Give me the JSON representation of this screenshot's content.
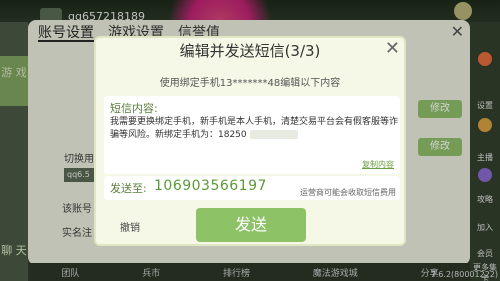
{
  "topbar": {
    "username": "qq657218189"
  },
  "left_tabs": [
    {
      "label": "游\n戏"
    },
    {
      "label": "聊\n天"
    }
  ],
  "settings": {
    "tabs": [
      {
        "label": "账号设置"
      },
      {
        "label": "游戏设置"
      },
      {
        "label": "信誉值"
      }
    ],
    "switch_label": "切换用",
    "account_label": "该账号",
    "verify_label": "实名注",
    "chip_text": "qq6.5",
    "buttons": [
      {
        "label": "修改"
      },
      {
        "label": "修改"
      }
    ]
  },
  "right_strip": {
    "items": [
      {
        "label": "设置"
      },
      {
        "label": "主播"
      },
      {
        "label": "攻略"
      },
      {
        "label": "加入"
      },
      {
        "label": "会员"
      },
      {
        "label": "新用户"
      }
    ],
    "promo": "更多集卡",
    "version": "7.6.2(80001222)"
  },
  "bottom_bar": [
    {
      "label": "团队"
    },
    {
      "label": "兵市"
    },
    {
      "label": "排行榜"
    },
    {
      "label": "魔法游戏城"
    },
    {
      "label": "分享"
    }
  ],
  "modal": {
    "title": "编辑并发送短信(3/3)",
    "subtitle": "使用绑定手机13*******48编辑以下内容",
    "sms_label": "短信内容:",
    "sms_body": "我需要更换绑定手机，新手机是本人手机，清楚交易平台会有假客服等诈骗等风险。新绑定手机为：18250",
    "copy_label": "复制内容",
    "send_to_label": "发送至:",
    "send_to_number": "106903566197",
    "send_to_note": "运营商可能会收取短信费用",
    "cancel_label": "撤销",
    "send_label": "发送"
  }
}
